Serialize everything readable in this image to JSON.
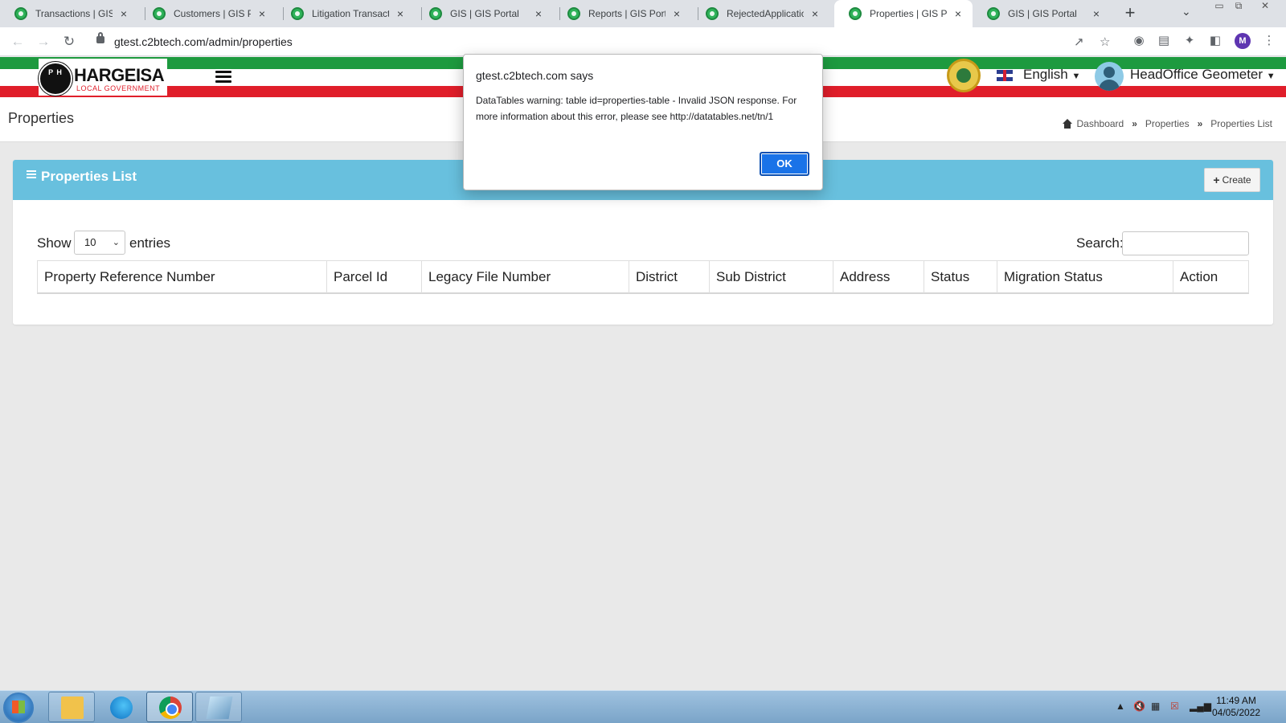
{
  "browser": {
    "tabs": [
      {
        "title": "Transactions | GIS Po",
        "active": false
      },
      {
        "title": "Customers | GIS Port",
        "active": false
      },
      {
        "title": "Litigation Transactio",
        "active": false
      },
      {
        "title": "GIS | GIS Portal",
        "active": false
      },
      {
        "title": "Reports | GIS Portal",
        "active": false
      },
      {
        "title": "RejectedApplication",
        "active": false
      },
      {
        "title": "Properties | GIS Port",
        "active": true
      },
      {
        "title": "GIS | GIS Portal",
        "active": false
      }
    ],
    "close_glyph": "×",
    "new_tab_glyph": "+",
    "url": "gtest.c2btech.com/admin/properties",
    "profile_initial": "M"
  },
  "app": {
    "logo_text": "HARGEISA",
    "logo_subtitle": "LOCAL GOVERNMENT",
    "logo_badge": "P H",
    "language": "English",
    "user_name": "HeadOffice Geometer",
    "brand_colors": {
      "green": "#1d9a3f",
      "red": "#e01e2a",
      "header_blue": "#68c0de"
    }
  },
  "page": {
    "title": "Properties",
    "breadcrumb": [
      "Dashboard",
      "Properties",
      "Properties List"
    ],
    "breadcrumb_separator": "»"
  },
  "card": {
    "title": "Properties List",
    "create_label": "Create",
    "show_label": "Show",
    "entries_value": "10",
    "entries_label": "entries",
    "search_label": "Search:",
    "search_value": "",
    "columns": [
      "Property Reference Number",
      "Parcel Id",
      "Legacy File Number",
      "District",
      "Sub District",
      "Address",
      "Status",
      "Migration Status",
      "Action"
    ]
  },
  "dialog": {
    "title": "gtest.c2btech.com says",
    "message": "DataTables warning: table id=properties-table - Invalid JSON response. For more information about this error, please see http://datatables.net/tn/1",
    "ok_label": "OK"
  },
  "taskbar": {
    "time": "11:49 AM",
    "date": "04/05/2022"
  }
}
